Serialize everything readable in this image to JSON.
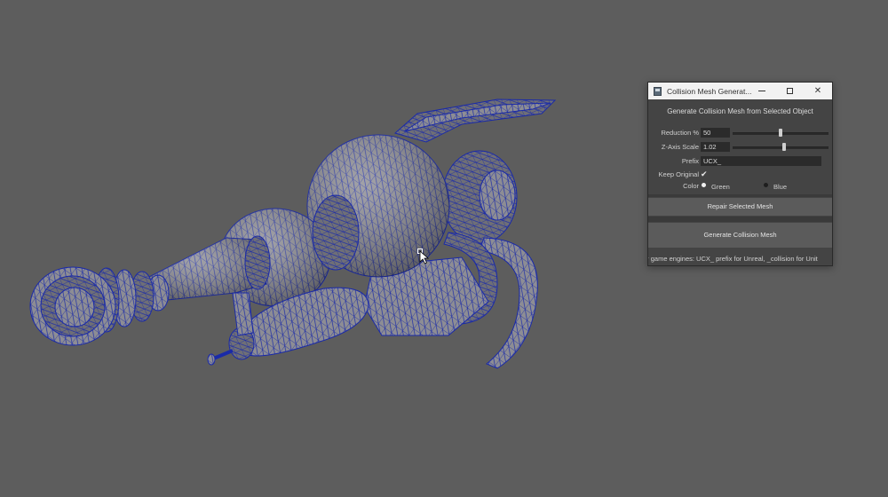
{
  "viewport": {
    "model_color": "#1a2aa8",
    "face_color": "#8b8b92",
    "background": "#5d5d5d",
    "model_name": "raygun-wireframe-mesh"
  },
  "window": {
    "title": "Collision Mesh Generat...",
    "icon": "maya-window-icon",
    "minimize_icon": "minimize-icon",
    "maximize_icon": "maximize-icon",
    "close_icon": "close-icon",
    "close_glyph": "✕",
    "heading": "Generate Collision Mesh from Selected Object",
    "reduction": {
      "label": "Reduction %",
      "value": "50",
      "slider_fraction": 0.5
    },
    "zscale": {
      "label": "Z-Axis Scale",
      "value": "1.02",
      "slider_fraction": 0.54
    },
    "prefix": {
      "label": "Prefix",
      "value": "UCX_"
    },
    "keep_original": {
      "label": "Keep Original",
      "checked": true,
      "glyph": "✔"
    },
    "color": {
      "label": "Color",
      "options": [
        {
          "label": "Green",
          "selected": true
        },
        {
          "label": "Blue",
          "selected": false
        }
      ]
    },
    "repair_button": "Repair Selected Mesh",
    "generate_button": "Generate Collision Mesh",
    "footer_note": "or game engines: UCX_ prefix for Unreal, _collision for Unit"
  }
}
